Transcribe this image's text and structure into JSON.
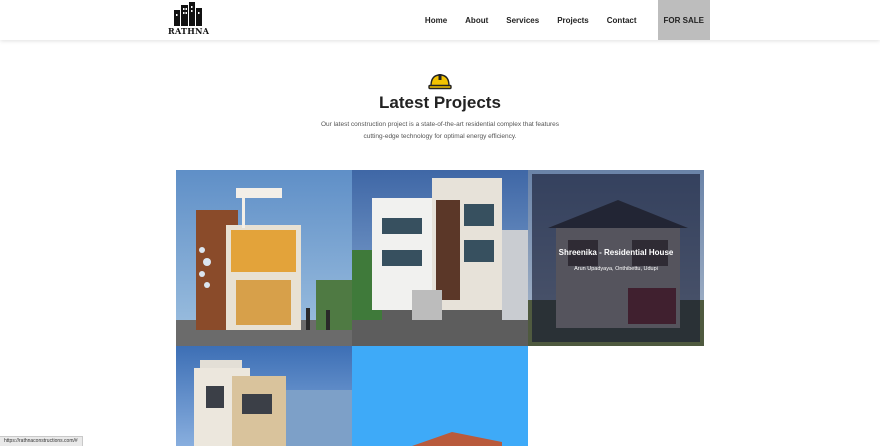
{
  "header": {
    "logo_text": "RATHNA",
    "nav": [
      {
        "label": "Home"
      },
      {
        "label": "About"
      },
      {
        "label": "Services"
      },
      {
        "label": "Projects"
      },
      {
        "label": "Contact"
      }
    ],
    "sale_label": "FOR SALE"
  },
  "section": {
    "icon": "helmet-icon",
    "title": "Latest Projects",
    "description": "Our latest construction project is a state-of-the-art residential complex that features cutting-edge technology for optimal energy efficiency."
  },
  "projects": [
    {
      "name": "",
      "location": ""
    },
    {
      "name": "",
      "location": ""
    },
    {
      "name": "Shreenika - Residential House",
      "location": "Arun Upadyaya, Onthibettu, Udupi"
    },
    {
      "name": "",
      "location": ""
    },
    {
      "name": "",
      "location": ""
    }
  ],
  "status_url": "https://rathnaconstructions.com/#",
  "colors": {
    "sale_bg": "#bdbdbd",
    "helmet": "#f2c200",
    "tile_blue": "#3eaaf8"
  }
}
